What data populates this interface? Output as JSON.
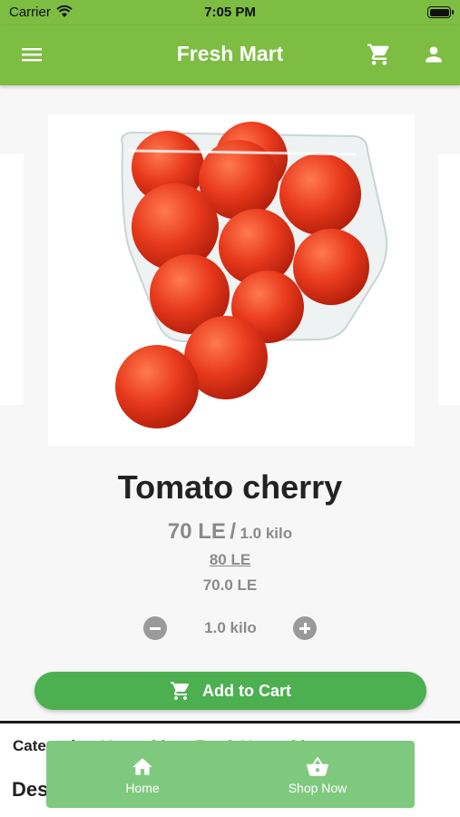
{
  "status_bar": {
    "carrier": "Carrier",
    "time": "7:05 PM"
  },
  "app_bar": {
    "title": "Fresh Mart"
  },
  "product": {
    "name": "Tomato cherry",
    "price": "70 LE",
    "price_separator": "/",
    "unit": "1.0  kilo",
    "old_price": "80 LE",
    "final_price": "70.0 LE",
    "quantity": "1.0  kilo"
  },
  "actions": {
    "add_to_cart": "Add  to Cart"
  },
  "details": {
    "categories_label": "Categories:",
    "categories_value": "Vegetables , Fresh Vegetables",
    "description_heading": "Description"
  },
  "bottom_nav": {
    "home_label": "Home",
    "shop_label": "Shop Now"
  },
  "colors": {
    "brand_green": "#7cbd42",
    "button_green": "#4caf50",
    "nav_green": "#7fc97f",
    "tomato_red": "#e8391c"
  },
  "icons": [
    "menu-icon",
    "cart-icon",
    "account-icon",
    "minus-icon",
    "plus-icon",
    "home-icon",
    "basket-icon"
  ]
}
